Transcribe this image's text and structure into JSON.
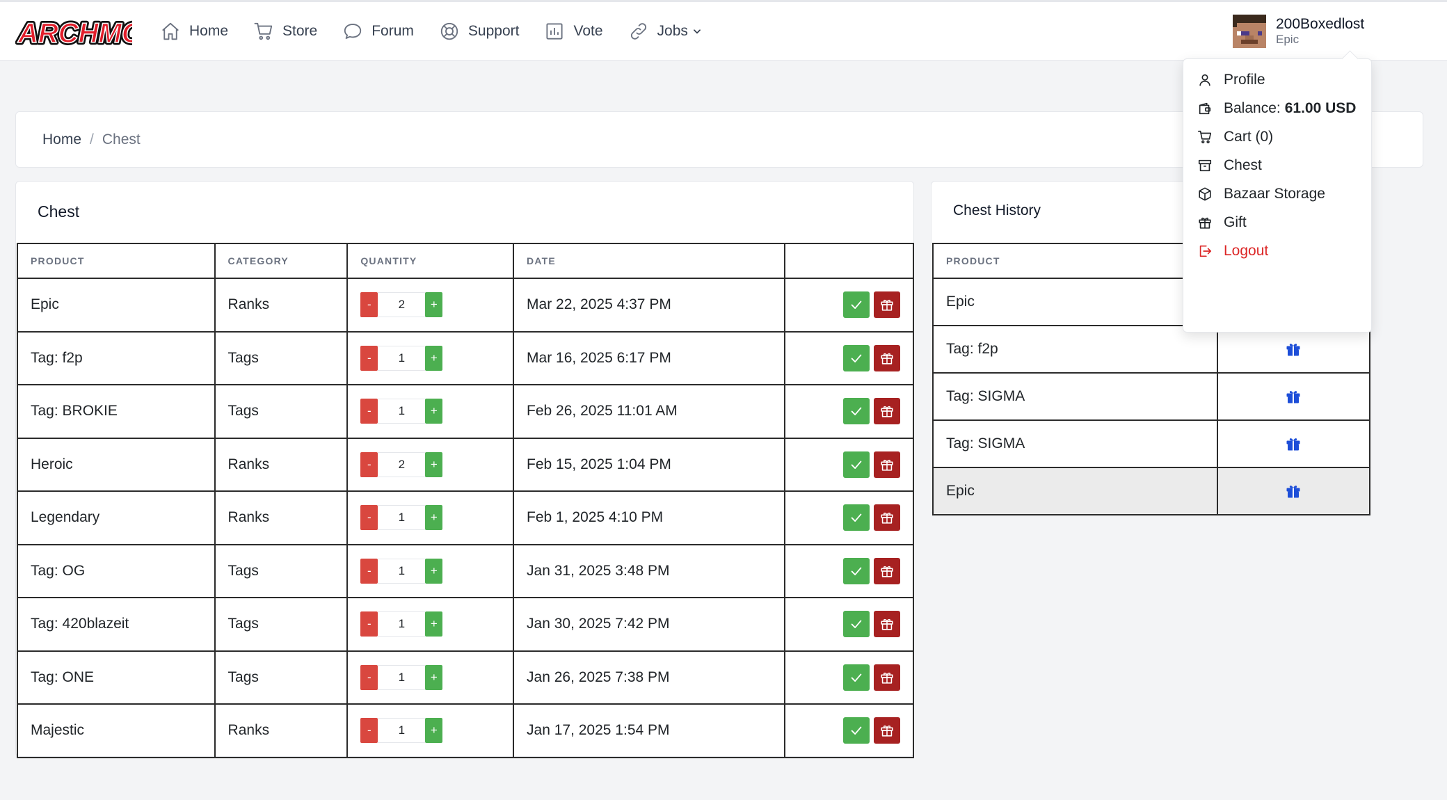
{
  "brand": {
    "logo_text": "ARCHMC"
  },
  "nav": {
    "items": [
      {
        "label": "Home",
        "icon": "home-icon"
      },
      {
        "label": "Store",
        "icon": "cart-icon"
      },
      {
        "label": "Forum",
        "icon": "chat-icon"
      },
      {
        "label": "Support",
        "icon": "lifebuoy-icon"
      },
      {
        "label": "Vote",
        "icon": "chart-icon"
      },
      {
        "label": "Jobs",
        "icon": "link-icon"
      }
    ]
  },
  "user": {
    "name": "200Boxedlost",
    "rank": "Epic"
  },
  "dropdown": {
    "profile": "Profile",
    "balance_label": "Balance:",
    "balance_value": "61.00 USD",
    "cart": "Cart (0)",
    "chest": "Chest",
    "bazaar": "Bazaar Storage",
    "gift": "Gift",
    "logout": "Logout"
  },
  "breadcrumb": {
    "home": "Home",
    "sep": "/",
    "current": "Chest"
  },
  "chest": {
    "title": "Chest",
    "columns": [
      "PRODUCT",
      "CATEGORY",
      "QUANTITY",
      "DATE",
      ""
    ],
    "minus": "-",
    "plus": "+",
    "rows": [
      {
        "product": "Epic",
        "category": "Ranks",
        "quantity": "2",
        "date": "Mar 22, 2025 4:37 PM"
      },
      {
        "product": "Tag: f2p",
        "category": "Tags",
        "quantity": "1",
        "date": "Mar 16, 2025 6:17 PM"
      },
      {
        "product": "Tag: BROKIE",
        "category": "Tags",
        "quantity": "1",
        "date": "Feb 26, 2025 11:01 AM"
      },
      {
        "product": "Heroic",
        "category": "Ranks",
        "quantity": "2",
        "date": "Feb 15, 2025 1:04 PM"
      },
      {
        "product": "Legendary",
        "category": "Ranks",
        "quantity": "1",
        "date": "Feb 1, 2025 4:10 PM"
      },
      {
        "product": "Tag: OG",
        "category": "Tags",
        "quantity": "1",
        "date": "Jan 31, 2025 3:48 PM"
      },
      {
        "product": "Tag: 420blazeit",
        "category": "Tags",
        "quantity": "1",
        "date": "Jan 30, 2025 7:42 PM"
      },
      {
        "product": "Tag: ONE",
        "category": "Tags",
        "quantity": "1",
        "date": "Jan 26, 2025 7:38 PM"
      },
      {
        "product": "Majestic",
        "category": "Ranks",
        "quantity": "1",
        "date": "Jan 17, 2025 1:54 PM"
      }
    ]
  },
  "history": {
    "title": "Chest History",
    "columns": [
      "PRODUCT",
      ""
    ],
    "rows": [
      {
        "product": "Epic"
      },
      {
        "product": "Tag: f2p"
      },
      {
        "product": "Tag: SIGMA"
      },
      {
        "product": "Tag: SIGMA"
      },
      {
        "product": "Epic"
      }
    ]
  },
  "colors": {
    "accent_green": "#4caf50",
    "danger_red": "#d9473f",
    "gift_red": "#a72121",
    "gift_blue": "#1d4ed8",
    "logout_red": "#dc2626"
  }
}
